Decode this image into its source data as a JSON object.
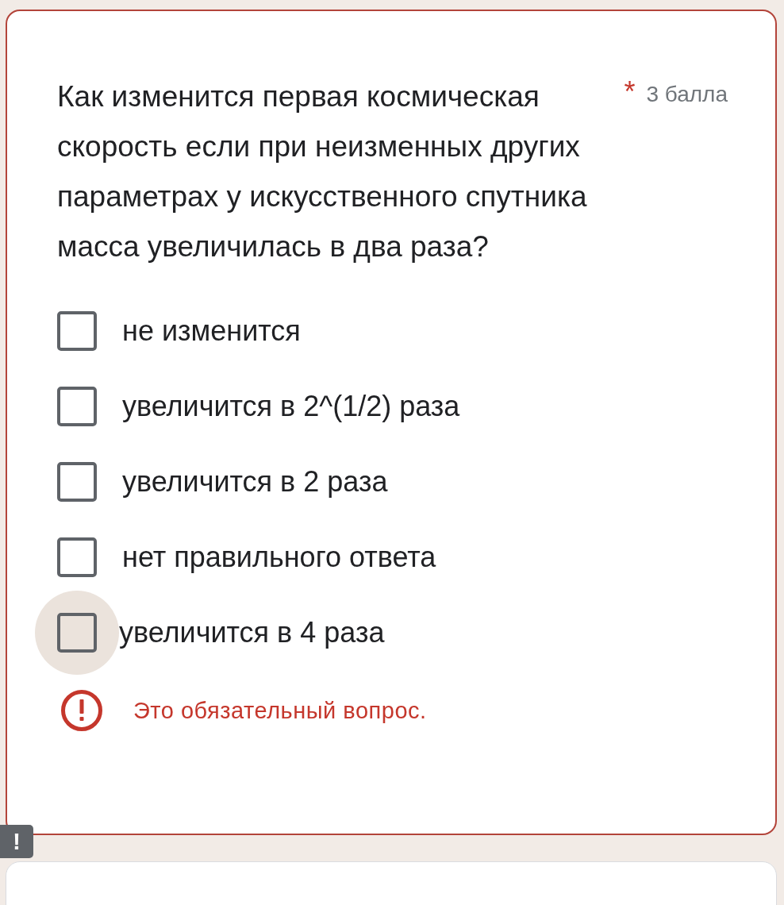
{
  "question": {
    "text": "Как изменится первая космическая скорость если при неизменных других параметрах у искусственного спутника масса увеличилась в два раза?",
    "required_mark": "*",
    "points": "3 балла"
  },
  "options": [
    {
      "label": "не изменится",
      "checked": false,
      "focused": false
    },
    {
      "label": "увеличится в 2^(1/2) раза",
      "checked": false,
      "focused": false
    },
    {
      "label": "увеличится в 2 раза",
      "checked": false,
      "focused": false
    },
    {
      "label": "нет правильного ответа",
      "checked": false,
      "focused": false
    },
    {
      "label": "увеличится в 4 раза",
      "checked": false,
      "focused": true
    }
  ],
  "error": "Это обязательный вопрос.",
  "side_badge": "!"
}
